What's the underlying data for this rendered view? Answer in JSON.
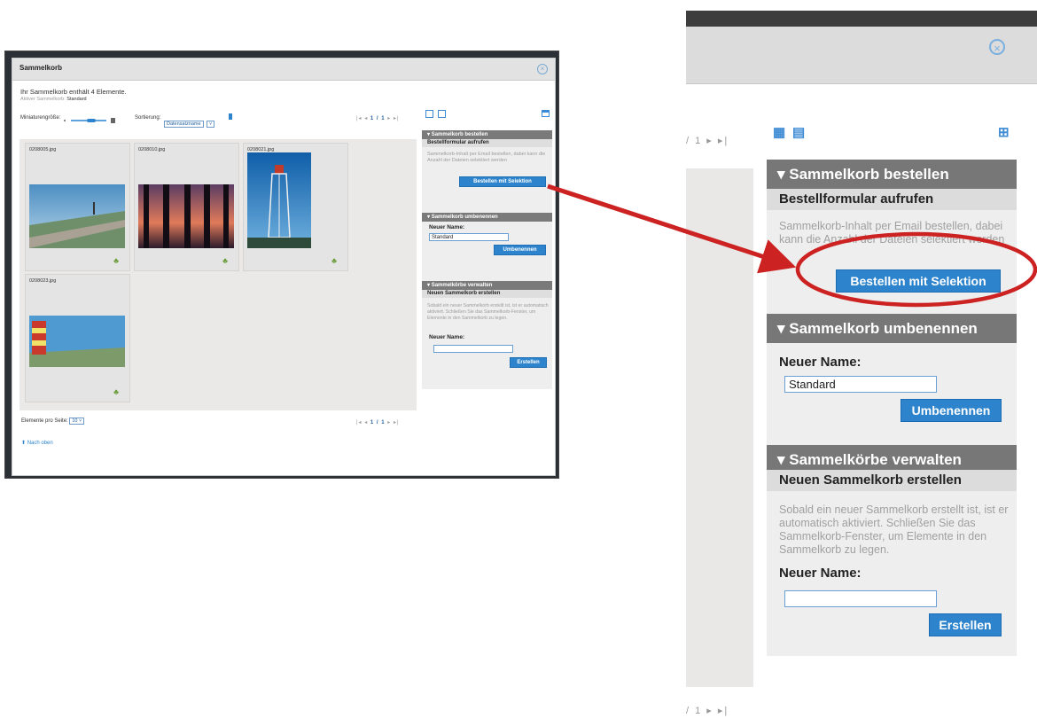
{
  "window": {
    "title": "Sammelkorb",
    "summary": "Ihr Sammelkorb enthält 4 Elemente.",
    "active_label": "Aktiver Sammelkorb:",
    "active_value": "Standard"
  },
  "toolbar": {
    "thumb_size_label": "Miniaturengröße:",
    "sort_label": "Sortierung:",
    "sort_value": "Datensatzname",
    "pager": "|◂ ◂ 1 / 1 ▸ ▸|",
    "pager_page": "1 / 1",
    "zoom_pager": "/ 1"
  },
  "thumbnails": [
    {
      "filename": "0208005.jpg",
      "icon": "basket-add-icon"
    },
    {
      "filename": "0208010.jpg",
      "icon": "basket-add-icon"
    },
    {
      "filename": "0208021.jpg",
      "icon": "basket-add-icon"
    },
    {
      "filename": "0208023.jpg",
      "icon": "basket-add-icon"
    }
  ],
  "footer": {
    "per_page_label": "Elemente pro Seite:",
    "per_page_value": "10",
    "back_to_top": "Nach oben"
  },
  "sidebar": {
    "order": {
      "title": "Sammelkorb bestellen",
      "subtitle": "Bestellformular aufrufen",
      "description": "Sammelkorb-Inhalt per Email bestellen, dabei kann die Anzahl der Dateien selektiert werden",
      "button": "Bestellen mit Selektion"
    },
    "rename": {
      "title": "Sammelkorb umbenennen",
      "label": "Neuer Name:",
      "value": "Standard",
      "button": "Umbenennen"
    },
    "manage": {
      "title": "Sammelkörbe verwalten",
      "subtitle": "Neuen Sammelkorb erstellen",
      "description": "Sobald ein neuer Sammelkorb erstellt ist, ist er automatisch aktiviert. Schließen Sie das Sammelkorb-Fenster, um Elemente in den Sammelkorb zu legen.",
      "label": "Neuer Name:",
      "value": "",
      "button": "Erstellen"
    }
  },
  "colors": {
    "accent": "#2d84cc",
    "section_header": "#777777",
    "arrow": "#cc2222"
  }
}
